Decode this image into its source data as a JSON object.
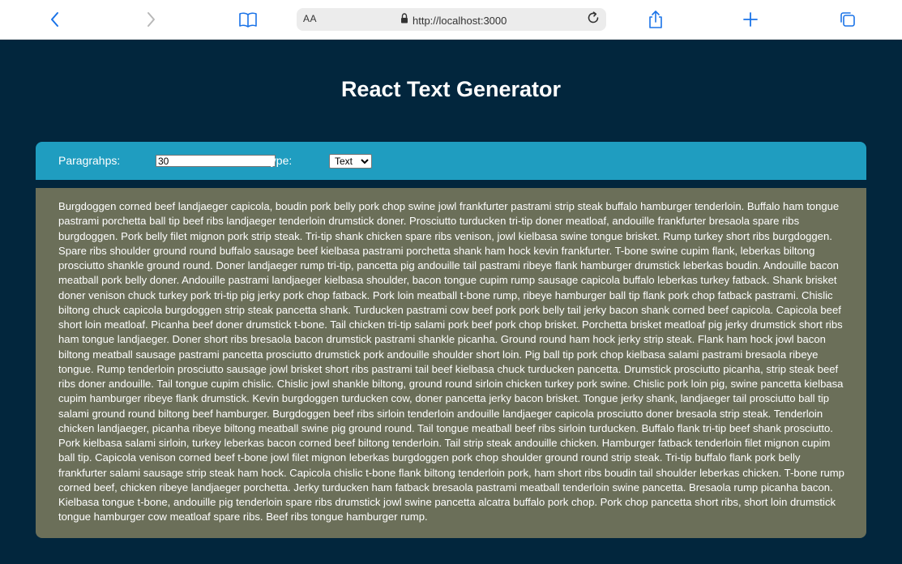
{
  "browser": {
    "aa_label": "AA",
    "url": "http://localhost:3000",
    "icons": {
      "back": "chevron-left-icon",
      "forward": "chevron-right-icon",
      "bookmarks": "book-icon",
      "lock": "lock-icon",
      "reload": "reload-icon",
      "share": "share-icon",
      "new_tab": "plus-icon",
      "tabs": "tabs-icon"
    },
    "accent_color": "#1a73e8"
  },
  "app": {
    "title": "React Text Generator",
    "background_color": "#02263d",
    "controls": {
      "paragraphs_label": "Paragrahps:",
      "paragraphs_value": "30",
      "type_label": "Type:",
      "type_selected": "Text",
      "bar_color": "#1f9dc0"
    },
    "text_panel": {
      "background_color": "#6b6f59",
      "content": "Burgdoggen corned beef landjaeger capicola, boudin pork belly pork chop swine jowl frankfurter pastrami strip steak buffalo hamburger tenderloin. Buffalo ham tongue pastrami porchetta ball tip beef ribs landjaeger tenderloin drumstick doner. Prosciutto turducken tri-tip doner meatloaf, andouille frankfurter bresaola spare ribs burgdoggen. Pork belly filet mignon pork strip steak. Tri-tip shank chicken spare ribs venison, jowl kielbasa swine tongue brisket. Rump turkey short ribs burgdoggen. Spare ribs shoulder ground round buffalo sausage beef kielbasa pastrami porchetta shank ham hock kevin frankfurter. T-bone swine cupim flank, leberkas biltong prosciutto shankle ground round. Doner landjaeger rump tri-tip, pancetta pig andouille tail pastrami ribeye flank hamburger drumstick leberkas boudin. Andouille bacon meatball pork belly doner. Andouille pastrami landjaeger kielbasa shoulder, bacon tongue cupim rump sausage capicola buffalo leberkas turkey fatback. Shank brisket doner venison chuck turkey pork tri-tip pig jerky pork chop fatback. Pork loin meatball t-bone rump, ribeye hamburger ball tip flank pork chop fatback pastrami. Chislic biltong chuck capicola burgdoggen strip steak pancetta shank. Turducken pastrami cow beef pork pork belly tail jerky bacon shank corned beef capicola. Capicola beef short loin meatloaf. Picanha beef doner drumstick t-bone. Tail chicken tri-tip salami pork beef pork chop brisket. Porchetta brisket meatloaf pig jerky drumstick short ribs ham tongue landjaeger. Doner short ribs bresaola bacon drumstick pastrami shankle picanha. Ground round ham hock jerky strip steak. Flank ham hock jowl bacon biltong meatball sausage pastrami pancetta prosciutto drumstick pork andouille shoulder short loin. Pig ball tip pork chop kielbasa salami pastrami bresaola ribeye tongue. Rump tenderloin prosciutto sausage jowl brisket short ribs pastrami tail beef kielbasa chuck turducken pancetta. Drumstick prosciutto picanha, strip steak beef ribs doner andouille. Tail tongue cupim chislic. Chislic jowl shankle biltong, ground round sirloin chicken turkey pork swine. Chislic pork loin pig, swine pancetta kielbasa cupim hamburger ribeye flank drumstick. Kevin burgdoggen turducken cow, doner pancetta jerky bacon brisket. Tongue jerky shank, landjaeger tail prosciutto ball tip salami ground round biltong beef hamburger. Burgdoggen beef ribs sirloin tenderloin andouille landjaeger capicola prosciutto doner bresaola strip steak. Tenderloin chicken landjaeger, picanha ribeye biltong meatball swine pig ground round. Tail tongue meatball beef ribs sirloin turducken. Buffalo flank tri-tip beef shank prosciutto. Pork kielbasa salami sirloin, turkey leberkas bacon corned beef biltong tenderloin. Tail strip steak andouille chicken. Hamburger fatback tenderloin filet mignon cupim ball tip. Capicola venison corned beef t-bone jowl filet mignon leberkas burgdoggen pork chop shoulder ground round strip steak. Tri-tip buffalo flank pork belly frankfurter salami sausage strip steak ham hock. Capicola chislic t-bone flank biltong tenderloin pork, ham short ribs boudin tail shoulder leberkas chicken. T-bone rump corned beef, chicken ribeye landjaeger porchetta. Jerky turducken ham fatback bresaola pastrami meatball tenderloin swine pancetta. Bresaola rump picanha bacon. Kielbasa tongue t-bone, andouille pig tenderloin spare ribs drumstick jowl swine pancetta alcatra buffalo pork chop. Pork chop pancetta short ribs, short loin drumstick tongue hamburger cow meatloaf spare ribs. Beef ribs tongue hamburger rump."
    }
  }
}
